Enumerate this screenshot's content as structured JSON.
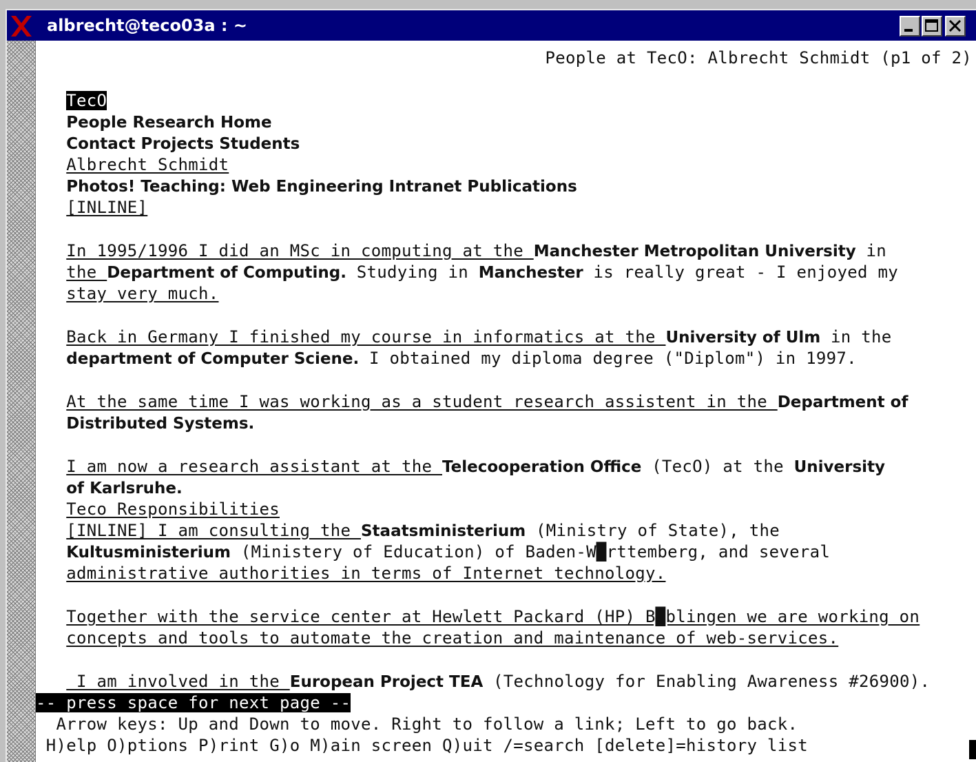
{
  "window": {
    "title": "albrecht@teco03a : ~",
    "icon": "x-logo-icon",
    "buttons": [
      "minimize-icon",
      "maximize-icon",
      "close-icon"
    ]
  },
  "page": {
    "header": "People at TecO: Albrecht Schmidt (p1 of 2)",
    "nav": {
      "teco": "TecO",
      "row1": "People Research Home",
      "row2": "Contact Projects Students",
      "name_link": "Albrecht Schmidt",
      "row3": "Photos! Teaching: Web Engineering Intranet Publications",
      "inline1": "[INLINE]"
    },
    "p1": {
      "a": "In 1995/1996 I did an MSc in computing at the ",
      "b": "Manchester Metropolitan University",
      "c": " in",
      "d": "the ",
      "e": "Department of Computing.",
      "f": " Studying in ",
      "g": "Manchester",
      "h": " is really great - I enjoyed my",
      "i": "stay very much."
    },
    "p2": {
      "a": "Back in Germany I finished my course in informatics at the ",
      "b": "University of Ulm",
      "c": " in the",
      "d": "department of Computer Sciene.",
      "e": " I obtained my diploma degree (\"Diplom\") in 1997."
    },
    "p3": {
      "a": "At the same time I was working as a student research assistent in the ",
      "b": "Department of",
      "c": "Distributed Systems."
    },
    "p4": {
      "a": "I am now a research assistant at the ",
      "b": "Telecooperation Office",
      "c": " (TecO) at the ",
      "d": "University",
      "e": "of Karlsruhe.",
      "f": "Teco Responsibilities",
      "g": "[INLINE] I am consulting the ",
      "h": "Staatsministerium",
      "i": " (Ministry of State), the",
      "j": "Kultusministerium",
      "k": " (Ministery of Education) of Baden-W█rttemberg, and several",
      "l": "administrative authorities in terms of Internet technology."
    },
    "p5": {
      "a": "Together with the service center at Hewlett Packard (HP) B█blingen we are working on",
      "b": "concepts and tools to automate the creation and maintenance of web-services."
    },
    "p6": {
      "a": " I am involved in the ",
      "b": "European Project TEA",
      "c": " (Technology for Enabling Awareness #26900)."
    }
  },
  "status": {
    "prompt": "-- press space for next page --",
    "help1": "  Arrow keys: Up and Down to move. Right to follow a link; Left to go back.",
    "help2": " H)elp O)ptions P)rint G)o M)ain screen Q)uit /=search [delete]=history list"
  }
}
